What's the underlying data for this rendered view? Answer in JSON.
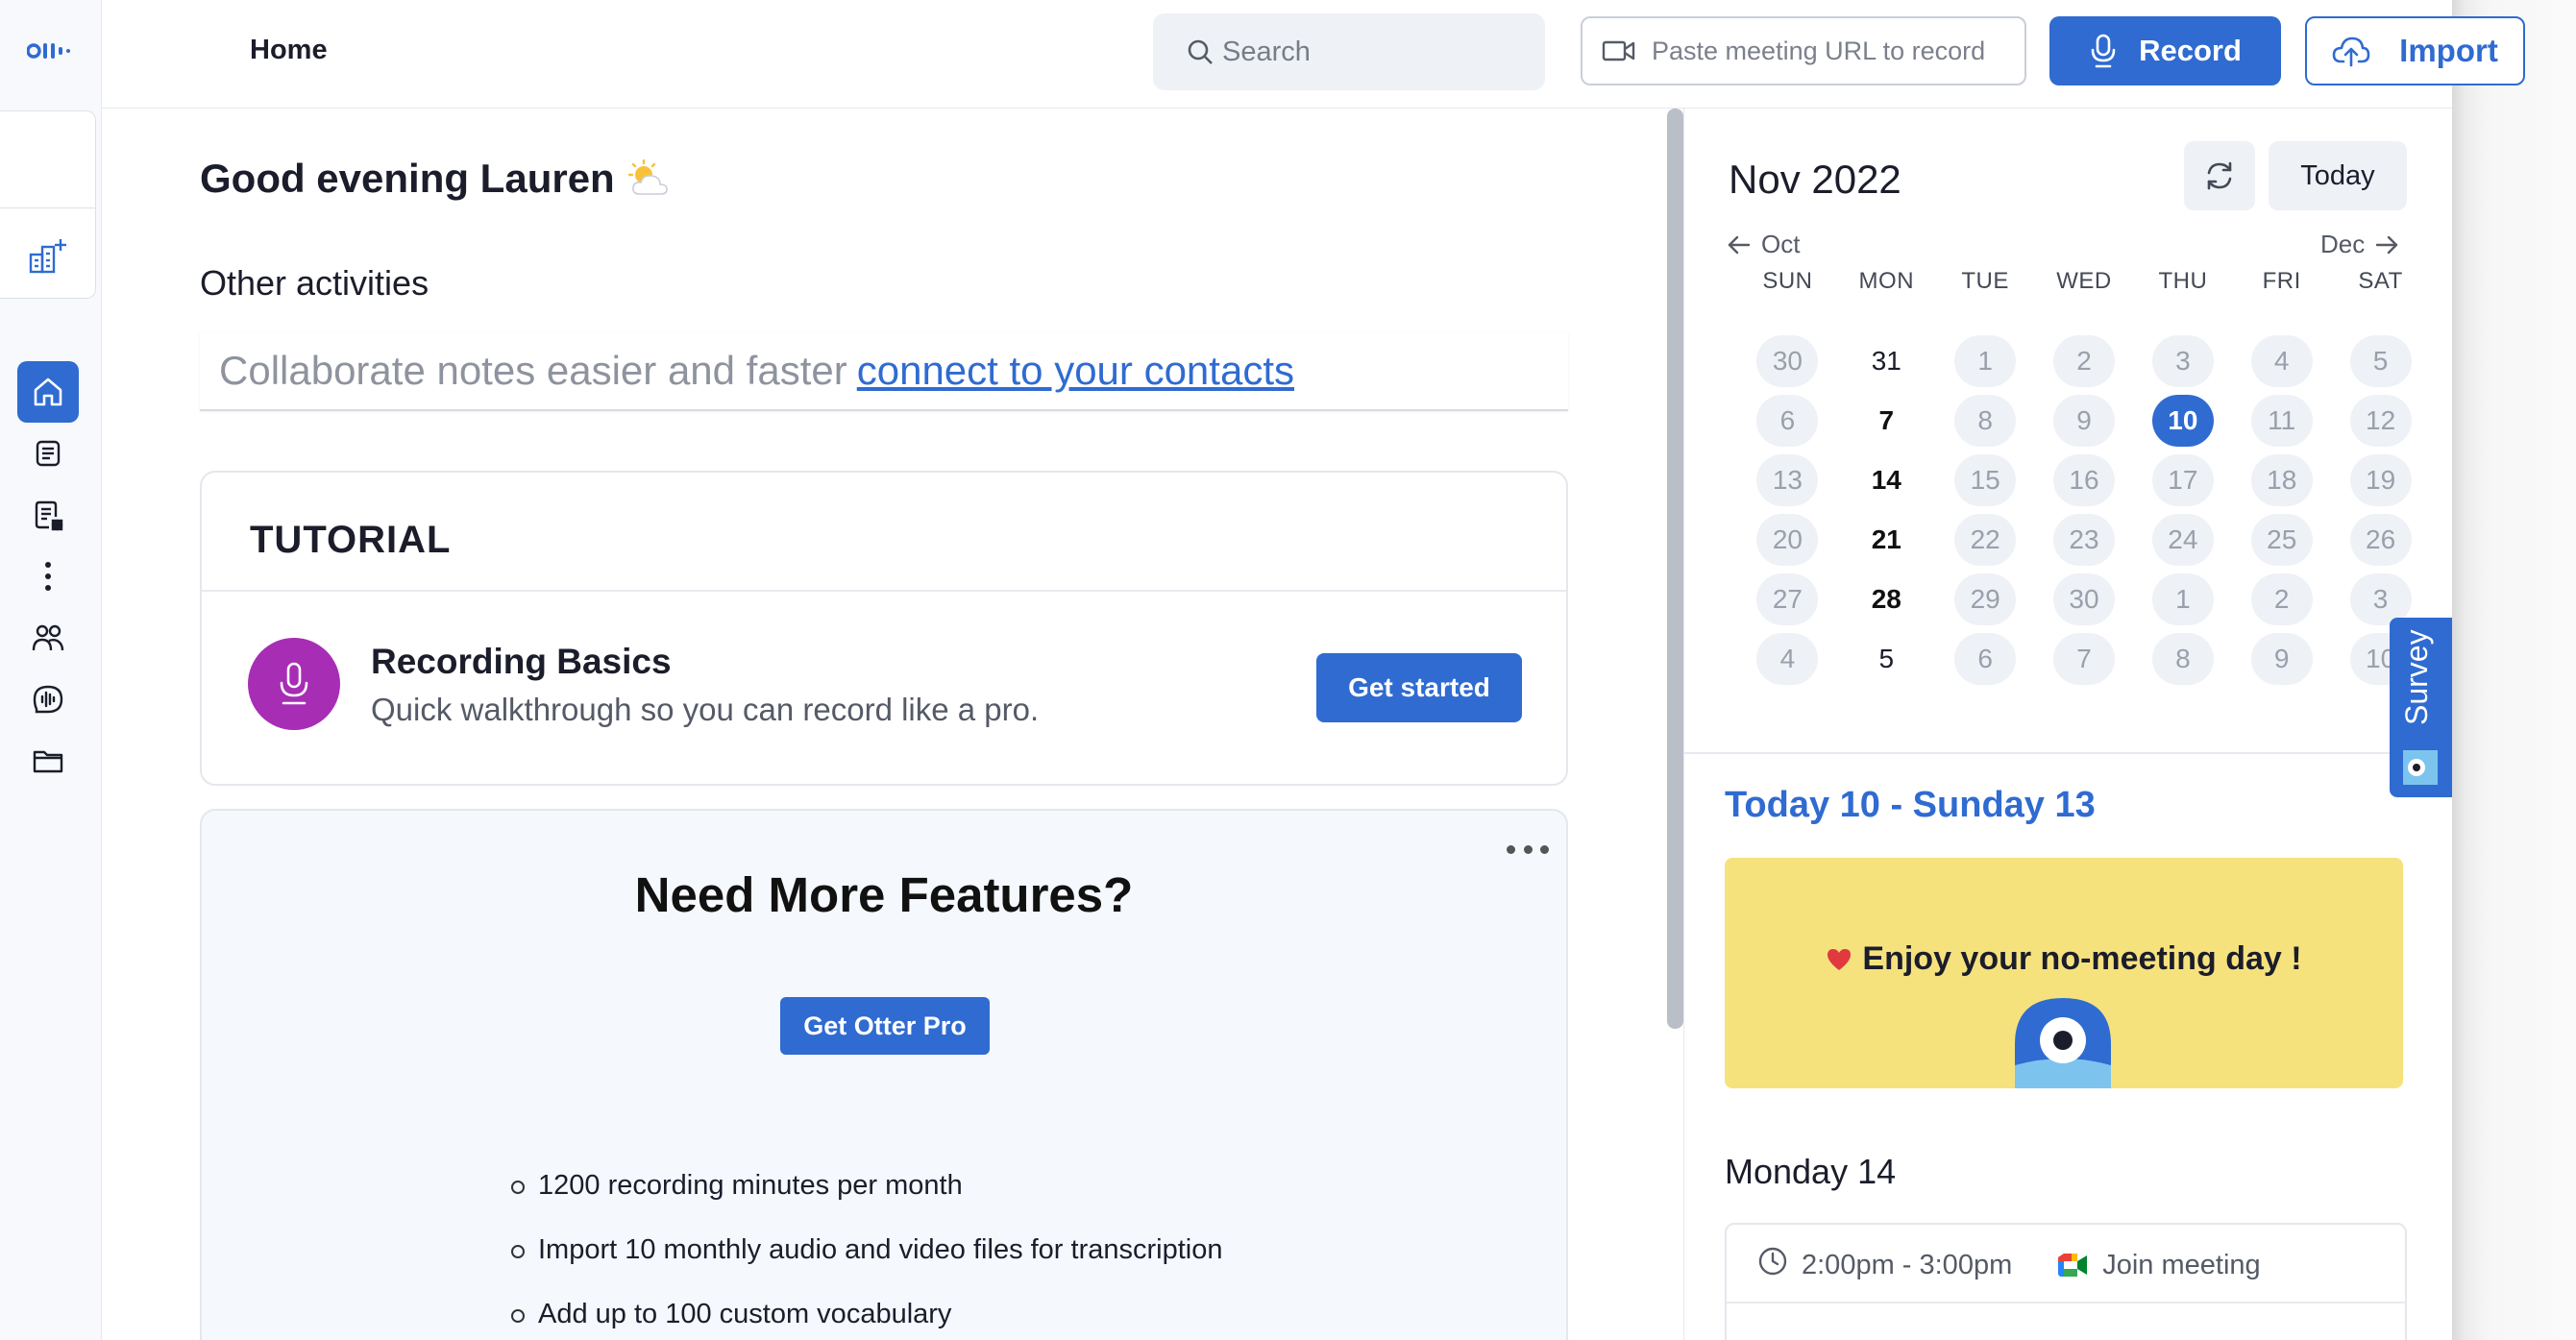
{
  "topbar": {
    "title": "Home",
    "search_placeholder": "Search",
    "url_placeholder": "Paste meeting URL to record",
    "record_label": "Record",
    "import_label": "Import"
  },
  "sidebar": {
    "items": [
      {
        "icon": "home-icon",
        "active": true
      },
      {
        "icon": "notes-icon"
      },
      {
        "icon": "my-conversations-icon"
      },
      {
        "icon": "more-icon"
      },
      {
        "icon": "people-icon"
      },
      {
        "icon": "otter-apps-icon"
      },
      {
        "icon": "folder-icon"
      }
    ]
  },
  "main": {
    "greeting": "Good evening Lauren",
    "other_activities": "Other activities",
    "collab_text": "Collaborate notes easier and faster",
    "collab_link": "connect to your contacts",
    "tutorial": {
      "heading": "TUTORIAL",
      "title": "Recording Basics",
      "description": "Quick walkthrough so you can record like a pro.",
      "button": "Get started"
    },
    "features": {
      "title": "Need More Features?",
      "button": "Get Otter Pro",
      "items": [
        "1200 recording minutes per month",
        "Import 10 monthly audio and video files for transcription",
        "Add up to 100 custom vocabulary"
      ]
    }
  },
  "calendar": {
    "month": "Nov 2022",
    "today_button": "Today",
    "prev": "Oct",
    "next": "Dec",
    "weekdays": [
      "SUN",
      "MON",
      "TUE",
      "WED",
      "THU",
      "FRI",
      "SAT"
    ],
    "weeks": [
      [
        {
          "d": "30",
          "s": "muted"
        },
        {
          "d": "31",
          "s": "plain"
        },
        {
          "d": "1",
          "s": "muted"
        },
        {
          "d": "2",
          "s": "muted"
        },
        {
          "d": "3",
          "s": "muted"
        },
        {
          "d": "4",
          "s": "muted"
        },
        {
          "d": "5",
          "s": "muted"
        }
      ],
      [
        {
          "d": "6",
          "s": "muted"
        },
        {
          "d": "7",
          "s": "bold"
        },
        {
          "d": "8",
          "s": "muted"
        },
        {
          "d": "9",
          "s": "muted"
        },
        {
          "d": "10",
          "s": "selected"
        },
        {
          "d": "11",
          "s": "muted"
        },
        {
          "d": "12",
          "s": "muted"
        }
      ],
      [
        {
          "d": "13",
          "s": "muted"
        },
        {
          "d": "14",
          "s": "bold"
        },
        {
          "d": "15",
          "s": "muted"
        },
        {
          "d": "16",
          "s": "muted"
        },
        {
          "d": "17",
          "s": "muted"
        },
        {
          "d": "18",
          "s": "muted"
        },
        {
          "d": "19",
          "s": "muted"
        }
      ],
      [
        {
          "d": "20",
          "s": "muted"
        },
        {
          "d": "21",
          "s": "bold"
        },
        {
          "d": "22",
          "s": "muted"
        },
        {
          "d": "23",
          "s": "muted"
        },
        {
          "d": "24",
          "s": "muted"
        },
        {
          "d": "25",
          "s": "muted"
        },
        {
          "d": "26",
          "s": "muted"
        }
      ],
      [
        {
          "d": "27",
          "s": "muted"
        },
        {
          "d": "28",
          "s": "bold"
        },
        {
          "d": "29",
          "s": "muted"
        },
        {
          "d": "30",
          "s": "muted"
        },
        {
          "d": "1",
          "s": "muted"
        },
        {
          "d": "2",
          "s": "muted"
        },
        {
          "d": "3",
          "s": "muted"
        }
      ],
      [
        {
          "d": "4",
          "s": "muted"
        },
        {
          "d": "5",
          "s": "plain"
        },
        {
          "d": "6",
          "s": "muted"
        },
        {
          "d": "7",
          "s": "muted"
        },
        {
          "d": "8",
          "s": "muted"
        },
        {
          "d": "9",
          "s": "muted"
        },
        {
          "d": "10",
          "s": "muted"
        }
      ]
    ]
  },
  "agenda": {
    "range_title": "Today 10 - Sunday 13",
    "no_meeting_text": "Enjoy your no-meeting day !",
    "day_heading": "Monday 14",
    "meeting_time": "2:00pm - 3:00pm",
    "join_label": "Join meeting"
  },
  "survey": {
    "label": "Survey"
  },
  "colors": {
    "accent": "#2f6bd1",
    "tutorial_avatar": "#a72db5",
    "no_meeting_bg": "#f6e27d"
  }
}
